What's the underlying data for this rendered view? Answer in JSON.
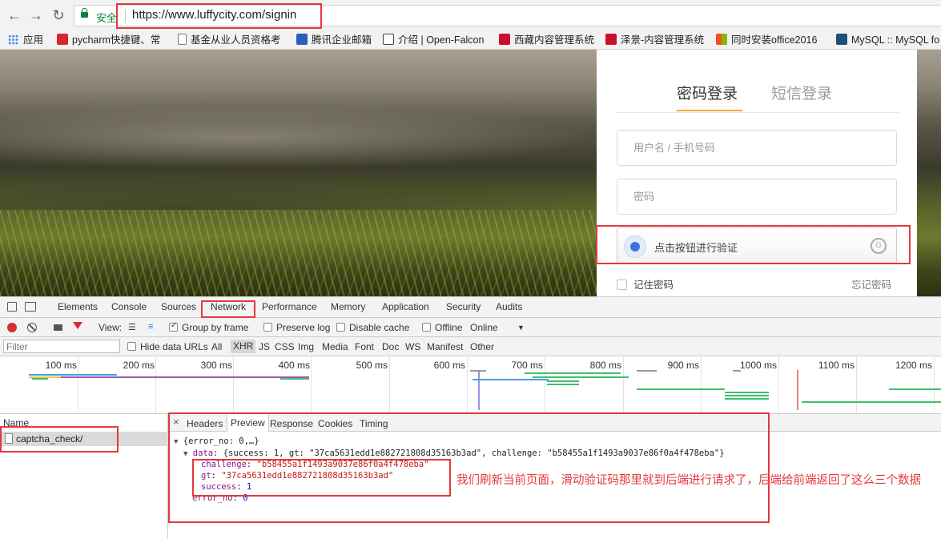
{
  "browser": {
    "secure_label": "安全",
    "url": "https://www.luffycity.com/signin"
  },
  "bookmarks": [
    {
      "label": "应用",
      "icon": "apps-grid-icon"
    },
    {
      "label": "pycharm快捷键、常",
      "icon": "c-red-icon"
    },
    {
      "label": "基金从业人员资格考",
      "icon": "page-icon"
    },
    {
      "label": "腾讯企业邮箱",
      "icon": "tencent-mail-icon"
    },
    {
      "label": "介绍 | Open-Falcon",
      "icon": "book-icon"
    },
    {
      "label": "西藏内容管理系统",
      "icon": "m-red-icon"
    },
    {
      "label": "泽景-内容管理系统",
      "icon": "m-red-icon"
    },
    {
      "label": "同时安装office2016",
      "icon": "office-icon"
    },
    {
      "label": "MySQL :: MySQL fo",
      "icon": "mysql-icon"
    }
  ],
  "login": {
    "tab_password": "密码登录",
    "tab_sms": "短信登录",
    "username_placeholder": "用户名 / 手机号码",
    "password_placeholder": "密码",
    "captcha_label": "点击按钮进行验证",
    "remember_label": "记住密码",
    "forgot_label": "忘记密码"
  },
  "devtools": {
    "tabs": [
      "Elements",
      "Console",
      "Sources",
      "Network",
      "Performance",
      "Memory",
      "Application",
      "Security",
      "Audits"
    ],
    "toolbar": {
      "view_label": "View:",
      "group_by_frame": "Group by frame",
      "preserve_log": "Preserve log",
      "disable_cache": "Disable cache",
      "offline": "Offline",
      "online": "Online"
    },
    "filter_placeholder": "Filter",
    "hide_data_urls": "Hide data URLs",
    "filter_types": [
      "All",
      "XHR",
      "JS",
      "CSS",
      "Img",
      "Media",
      "Font",
      "Doc",
      "WS",
      "Manifest",
      "Other"
    ],
    "timeline_ticks": [
      "100 ms",
      "200 ms",
      "300 ms",
      "400 ms",
      "500 ms",
      "600 ms",
      "700 ms",
      "800 ms",
      "900 ms",
      "1000 ms",
      "1100 ms",
      "1200 ms"
    ],
    "name_header": "Name",
    "request_name": "captcha_check/",
    "detail_tabs": [
      "Headers",
      "Preview",
      "Response",
      "Cookies",
      "Timing"
    ],
    "preview": {
      "summary": "{error_no: 0,…}",
      "data_line_key": "data",
      "data_line_value": "{success: 1, gt: \"37ca5631edd1e882721808d35163b3ad\", challenge: \"b58455a1f1493a9037e86f0a4f478eba\"}",
      "challenge_key": "challenge",
      "challenge_value": "\"b58455a1f1493a9037e86f0a4f478eba\"",
      "gt_key": "gt",
      "gt_value": "\"37ca5631edd1e882721808d35163b3ad\"",
      "success_key": "success",
      "success_value": "1",
      "error_no_key": "error_no",
      "error_no_value": "0"
    }
  },
  "annotation": "我们刷新当前页面，滑动验证码那里就到后端进行请求了，后端给前端返回了这么三个数据"
}
